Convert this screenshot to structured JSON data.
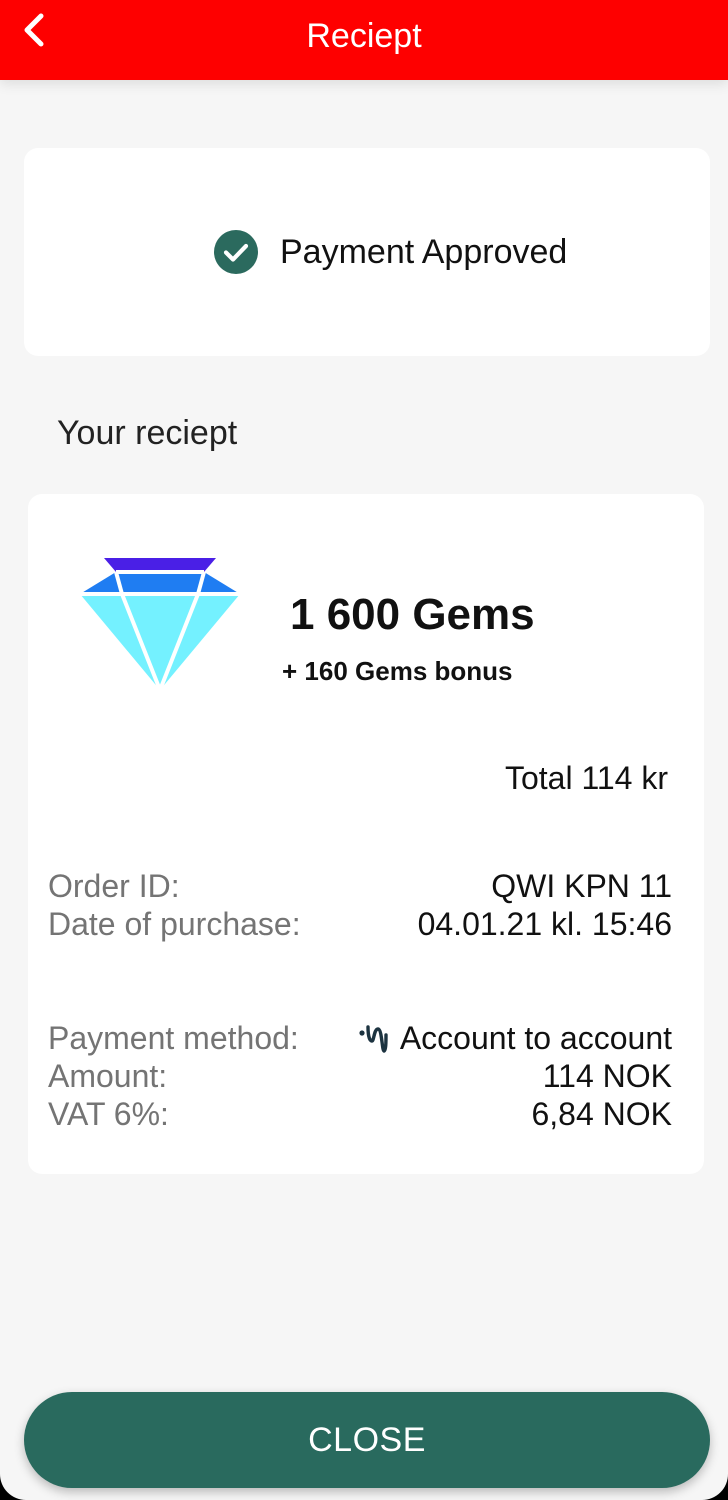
{
  "appbar": {
    "title": "Reciept",
    "back_icon": "chevron-left-icon"
  },
  "status": {
    "text": "Payment Approved",
    "icon": "check-circle-icon",
    "icon_color": "#2b6a5e"
  },
  "section": {
    "heading": "Your reciept"
  },
  "product": {
    "icon": "diamond-gem-icon",
    "title": "1 600 Gems",
    "bonus": "+ 160 Gems bonus",
    "total": "Total 114 kr"
  },
  "order": {
    "id_label": "Order ID:",
    "id_value": "QWI KPN 11",
    "date_label": "Date of purchase:",
    "date_value": "04.01.21 kl. 15:46"
  },
  "payment": {
    "method_label": "Payment method:",
    "method_icon": "transfer-icon",
    "method_value": "Account to account",
    "amount_label": "Amount:",
    "amount_value": "114 NOK",
    "vat_label": "VAT 6%:",
    "vat_value": "6,84 NOK"
  },
  "footer": {
    "close_label": "CLOSE",
    "button_color": "#296a5e"
  },
  "colors": {
    "appbar": "#fe0000",
    "background": "#f6f6f6"
  }
}
